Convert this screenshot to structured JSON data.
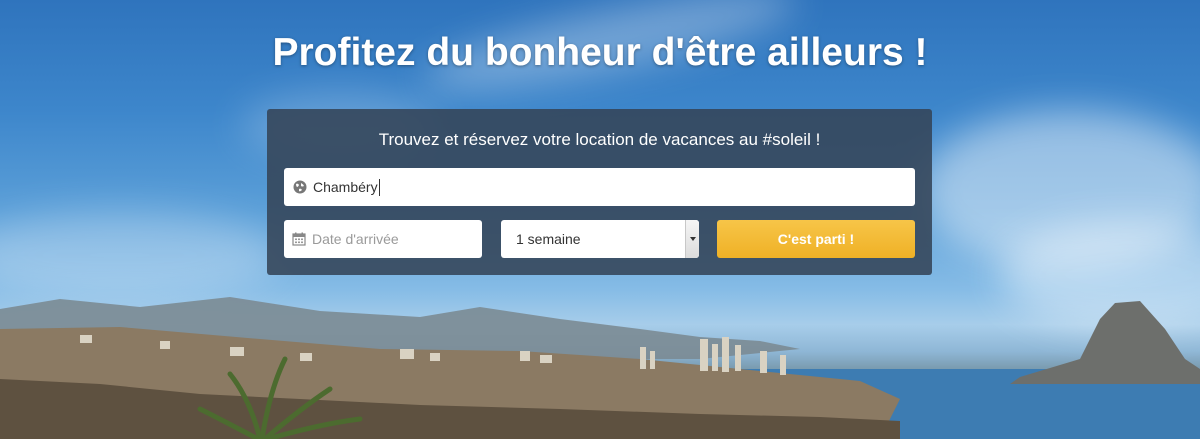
{
  "hero": {
    "headline": "Profitez du bonheur d'être ailleurs !"
  },
  "search": {
    "subtitle": "Trouvez et réservez votre location de vacances au #soleil !",
    "destination": {
      "value": "Chambéry",
      "icon": "globe-icon"
    },
    "arrival_date": {
      "placeholder": "Date d'arrivée",
      "icon": "calendar-icon"
    },
    "duration": {
      "selected": "1 semaine",
      "icon": "dropdown-arrow-icon"
    },
    "submit_label": "C'est parti !"
  },
  "colors": {
    "panel_bg": "#344458",
    "button_bg": "#f0b429",
    "button_text": "#ffffff"
  }
}
